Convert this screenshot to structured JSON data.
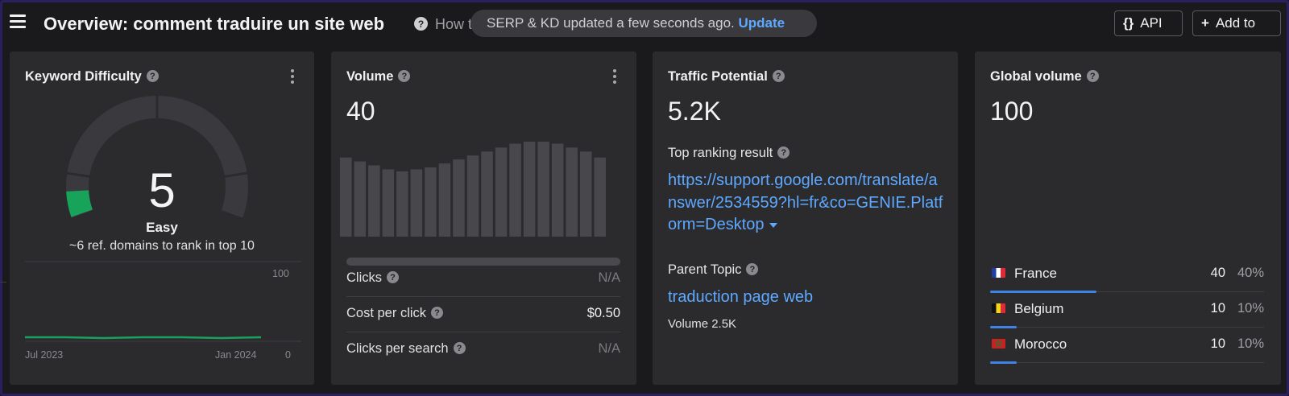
{
  "header": {
    "title": "Overview: comment traduire un site web",
    "how_text": "How t",
    "toast_text": "SERP & KD updated a few seconds ago.",
    "toast_action": "Update",
    "api_icon": "{}",
    "api_label": "API",
    "add_icon": "+",
    "add_label": "Add to"
  },
  "keyword_difficulty": {
    "title": "Keyword Difficulty",
    "value": "5",
    "score": 5,
    "label": "Easy",
    "subtitle": "~6 ref. domains to rank in top 10",
    "chart": {
      "y_max_label": "100",
      "y_min_label": "0",
      "x_start_label": "Jul 2023",
      "x_end_label": "Jan 2024"
    }
  },
  "volume": {
    "title": "Volume",
    "value": "40",
    "rows": [
      {
        "label": "Clicks",
        "value": "N/A"
      },
      {
        "label": "Cost per click",
        "value": "$0.50"
      },
      {
        "label": "Clicks per search",
        "value": "N/A"
      }
    ]
  },
  "traffic_potential": {
    "title": "Traffic Potential",
    "value": "5.2K",
    "top_ranking_label": "Top ranking result",
    "top_ranking_url": "https://support.google.com/translate/answer/2534559?hl=fr&co=GENIE.Platform=Desktop",
    "parent_topic_label": "Parent Topic",
    "parent_topic_link": "traduction page web",
    "parent_topic_volume": "Volume 2.5K"
  },
  "global_volume": {
    "title": "Global volume",
    "value": "100",
    "countries": [
      {
        "name": "France",
        "volume": "40",
        "percent": "40%",
        "share": 0.4,
        "flag": "flag-france-icon"
      },
      {
        "name": "Belgium",
        "volume": "10",
        "percent": "10%",
        "share": 0.1,
        "flag": "flag-belgium-icon"
      },
      {
        "name": "Morocco",
        "volume": "10",
        "percent": "10%",
        "share": 0.1,
        "flag": "flag-morocco-icon"
      }
    ]
  },
  "chart_data": [
    {
      "type": "line",
      "series": [
        {
          "values": [
            5,
            5,
            4,
            5,
            5,
            4,
            5
          ]
        }
      ],
      "ylim": [
        0,
        100
      ],
      "xlabel": "",
      "ylabel": ""
    },
    {
      "type": "bar",
      "values": [
        40,
        38,
        36,
        34,
        33,
        34,
        35,
        37,
        39,
        41,
        43,
        45,
        47,
        48,
        48,
        47,
        45,
        43,
        40
      ],
      "ylim": [
        0,
        48
      ]
    }
  ],
  "colors": {
    "accent_link": "#5ea9ff",
    "kd_green": "#17a35a",
    "bar_blue": "#3f84e5",
    "card_bg": "#2b2b2e"
  }
}
